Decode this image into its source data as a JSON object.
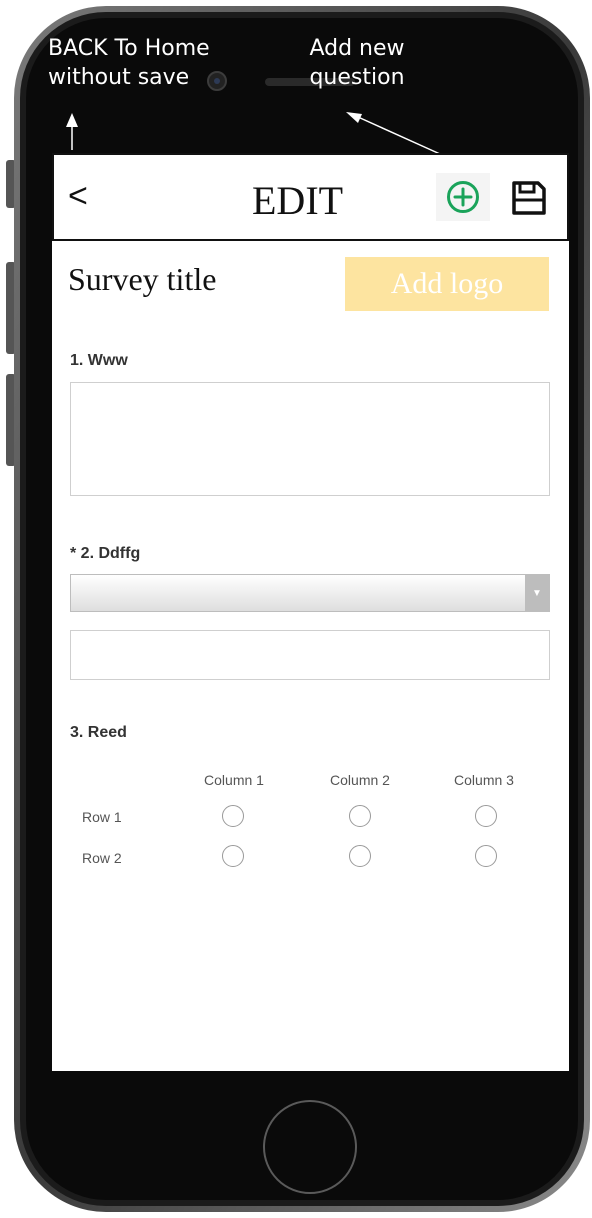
{
  "annotations": {
    "back_line1": "BACK To Home",
    "back_line2": "without save",
    "add_line1": "Add new",
    "add_line2": "question"
  },
  "topbar": {
    "back_label": "<",
    "title": "EDIT",
    "add_icon": "plus-circle-icon",
    "save_icon": "floppy-disk-icon"
  },
  "survey": {
    "title": "Survey title",
    "add_logo_label": "Add logo"
  },
  "questions": [
    {
      "label": "1. Www",
      "type": "textarea"
    },
    {
      "label": "* 2. Ddffg",
      "type": "dropdown"
    },
    {
      "label": "3. Reed",
      "type": "matrix",
      "columns": [
        "Column 1",
        "Column 2",
        "Column 3"
      ],
      "rows": [
        "Row 1",
        "Row 2"
      ]
    }
  ],
  "colors": {
    "logo_bg": "#fde4a0",
    "add_icon": "#1aa35a",
    "frame": "#1c1c1c"
  }
}
